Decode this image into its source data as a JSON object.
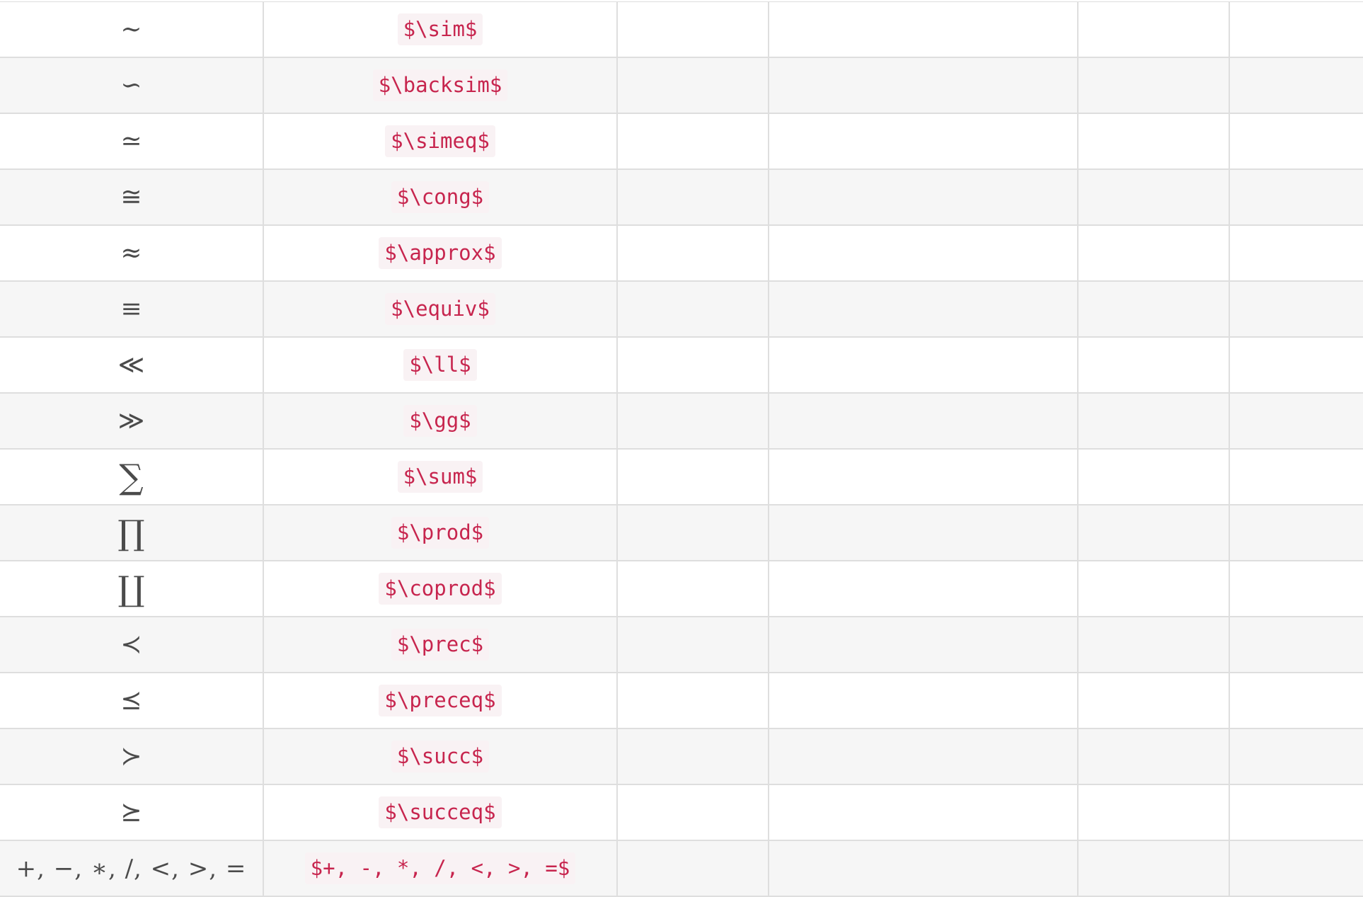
{
  "rows": [
    {
      "symbol": "∼",
      "latex": "$\\sim$"
    },
    {
      "symbol": "∽",
      "latex": "$\\backsim$"
    },
    {
      "symbol": "≃",
      "latex": "$\\simeq$"
    },
    {
      "symbol": "≅",
      "latex": "$\\cong$"
    },
    {
      "symbol": "≈",
      "latex": "$\\approx$"
    },
    {
      "symbol": "≡",
      "latex": "$\\equiv$"
    },
    {
      "symbol": "≪",
      "latex": "$\\ll$"
    },
    {
      "symbol": "≫",
      "latex": "$\\gg$"
    },
    {
      "symbol": "∑",
      "latex": "$\\sum$"
    },
    {
      "symbol": "∏",
      "latex": "$\\prod$"
    },
    {
      "symbol": "∐",
      "latex": "$\\coprod$"
    },
    {
      "symbol": "≺",
      "latex": "$\\prec$"
    },
    {
      "symbol": "⪯",
      "latex": "$\\preceq$"
    },
    {
      "symbol": "≻",
      "latex": "$\\succ$"
    },
    {
      "symbol": "⪰",
      "latex": "$\\succeq$"
    },
    {
      "symbol": "+, −, ∗, /, <, >, =",
      "latex": "$+, -, *, /, <, >, =$"
    }
  ]
}
